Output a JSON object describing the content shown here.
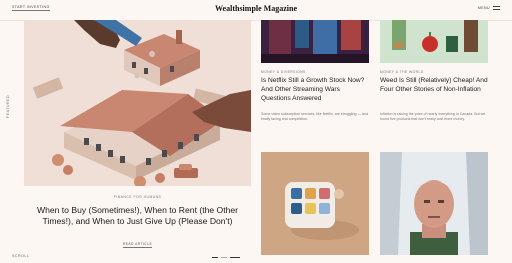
{
  "header": {
    "start_investing": "START INVESTING",
    "brand": "Wealthsimple Magazine",
    "menu": "MENU"
  },
  "side": {
    "featured": "FEATURED",
    "scroll": "SCROLL"
  },
  "hero": {
    "category": "FINANCE FOR HUMANS",
    "title": "When to Buy (Sometimes!), When to Rent (the Other Times!), and When to Just Give Up (Please Don't)",
    "cta": "READ ARTICLE"
  },
  "cards": [
    {
      "category": "MONEY & DIVERSIONS",
      "title": "Is Netflix Still a Growth Stock Now? And Other Streaming Wars Questions Answered",
      "excerpt": "Some video subscription services, like Netflix, are struggling — and finally facing real competition."
    },
    {
      "category": "MONEY & THE WORLD",
      "title": "Weed Is Still (Relatively) Cheap! And Four Other Stories of Non-Inflation",
      "excerpt": "Inflation is raising the price of nearly everything in Canada. But we found five products that don't really cost more money."
    }
  ],
  "colors": {
    "background": "#fdf7f4",
    "hero_bg": "#efdfd6",
    "tan_card": "#cfa684",
    "mint_card": "#cfe3cf"
  }
}
